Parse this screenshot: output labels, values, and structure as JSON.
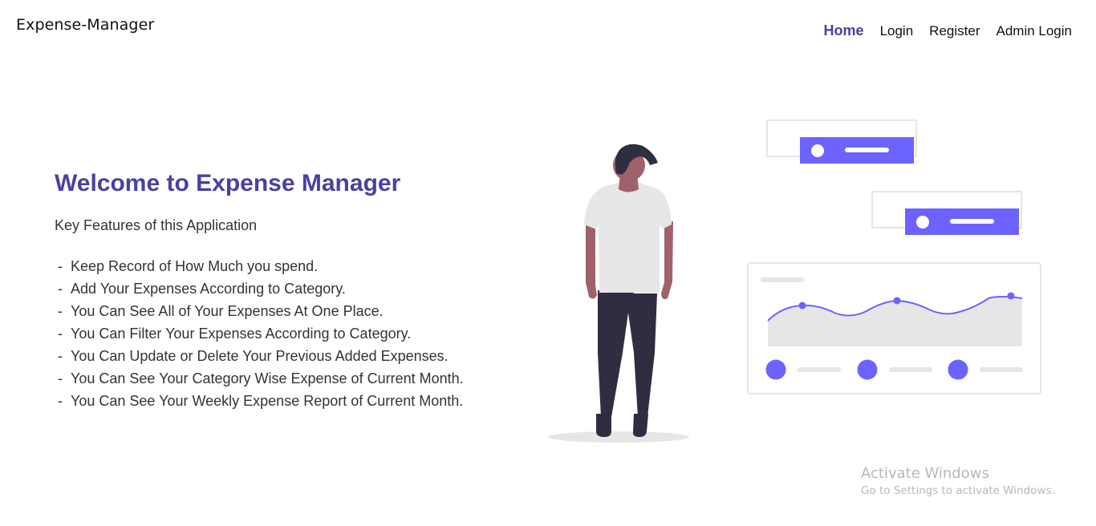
{
  "brand": "Expense-Manager",
  "nav": {
    "home": "Home",
    "login": "Login",
    "register": "Register",
    "admin_login": "Admin Login"
  },
  "hero": {
    "title": "Welcome to Expense Manager",
    "subtitle": "Key Features of this Application",
    "features": [
      "Keep Record of How Much you spend.",
      "Add Your Expenses According to Category.",
      "You Can See All of Your Expenses At One Place.",
      "You Can Filter Your Expenses According to Category.",
      "You Can Update or Delete Your Previous Added Expenses.",
      "You Can See Your Category Wise Expense of Current Month.",
      "You Can See Your Weekly Expense Report of Current Month."
    ]
  },
  "watermark": {
    "title": "Activate Windows",
    "subtitle": "Go to Settings to activate Windows."
  },
  "colors": {
    "accent": "#6c63ff",
    "title": "#4a40a2",
    "nav_active": "#48409c",
    "skin": "#a0616a",
    "hair": "#2f2e41",
    "pants": "#2f2e41",
    "shirt": "#e6e6e6"
  }
}
